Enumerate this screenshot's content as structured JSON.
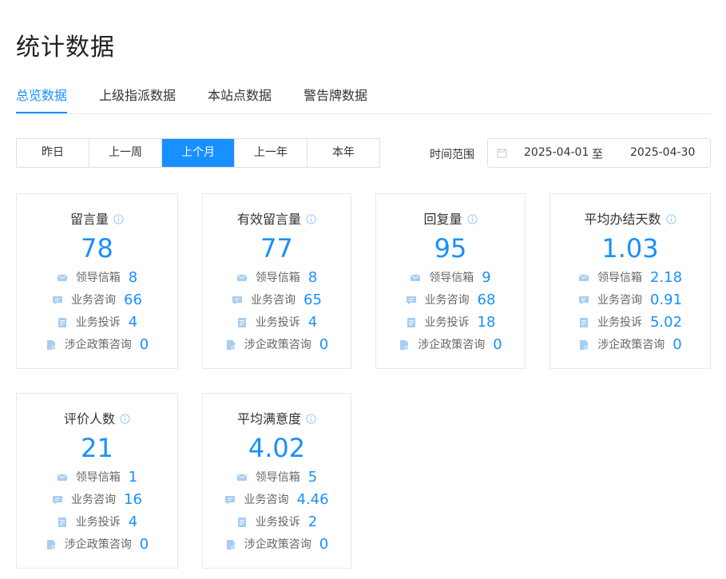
{
  "page_title": "统计数据",
  "tabs": [
    "总览数据",
    "上级指派数据",
    "本站点数据",
    "警告牌数据"
  ],
  "active_tab": 0,
  "periods": [
    "昨日",
    "上一周",
    "上个月",
    "上一年",
    "本年"
  ],
  "active_period": 2,
  "range": {
    "label": "时间范围",
    "start": "2025-04-01",
    "separator": "至",
    "end": "2025-04-30"
  },
  "row_labels": [
    "领导信箱",
    "业务咨询",
    "业务投诉",
    "涉企政策咨询"
  ],
  "cards": [
    {
      "title": "留言量",
      "value": "78",
      "rows": [
        "8",
        "66",
        "4",
        "0"
      ]
    },
    {
      "title": "有效留言量",
      "value": "77",
      "rows": [
        "8",
        "65",
        "4",
        "0"
      ]
    },
    {
      "title": "回复量",
      "value": "95",
      "rows": [
        "9",
        "68",
        "18",
        "0"
      ]
    },
    {
      "title": "平均办结天数",
      "value": "1.03",
      "rows": [
        "2.18",
        "0.91",
        "5.02",
        "0"
      ]
    },
    {
      "title": "评价人数",
      "value": "21",
      "rows": [
        "1",
        "16",
        "4",
        "0"
      ]
    },
    {
      "title": "平均满意度",
      "value": "4.02",
      "rows": [
        "5",
        "4.46",
        "2",
        "0"
      ]
    }
  ],
  "colors": {
    "accent": "#1890ff",
    "icon": "#a6cdf4",
    "border": "#e8e8e8"
  }
}
